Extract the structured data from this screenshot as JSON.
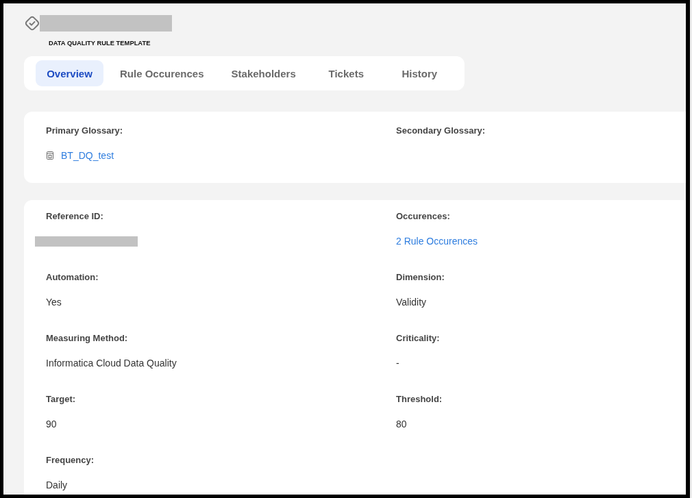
{
  "header": {
    "title": {
      "redacted": true
    },
    "subtitle": "DATA QUALITY RULE TEMPLATE"
  },
  "tabs": [
    {
      "label": "Overview",
      "selected": true
    },
    {
      "label": "Rule Occurences",
      "selected": false
    },
    {
      "label": "Stakeholders",
      "selected": false
    },
    {
      "label": "Tickets",
      "selected": false
    },
    {
      "label": "History",
      "selected": false
    }
  ],
  "glossary_card": {
    "fields": [
      {
        "label": "Primary Glossary:",
        "kind": "glossary-link",
        "value": "BT_DQ_test"
      },
      {
        "label": "Secondary Glossary:",
        "kind": "text"
      }
    ]
  },
  "details_card": {
    "fields": [
      {
        "label": "Reference ID:",
        "kind": "redacted"
      },
      {
        "label": "Occurences:",
        "kind": "link",
        "value": "2 Rule Occurences"
      },
      {
        "label": "Automation:",
        "kind": "text",
        "value": "Yes"
      },
      {
        "label": "Dimension:",
        "kind": "text",
        "value": "Validity"
      },
      {
        "label": "Measuring Method:",
        "kind": "text",
        "value": "Informatica Cloud Data Quality"
      },
      {
        "label": "Criticality:",
        "kind": "text",
        "value": "-"
      },
      {
        "label": "Target:",
        "kind": "text",
        "value": "90"
      },
      {
        "label": "Threshold:",
        "kind": "text",
        "value": "80"
      },
      {
        "label": "Frequency:",
        "kind": "text",
        "value": "Daily"
      }
    ]
  }
}
